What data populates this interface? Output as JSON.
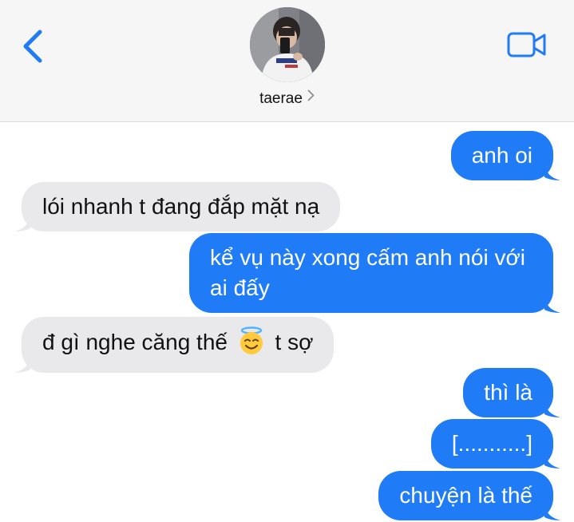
{
  "header": {
    "contact_name": "taerae",
    "back_icon": "chevron-left-icon",
    "video_icon": "video-camera-icon",
    "accent_color": "#1f7bf6"
  },
  "messages": [
    {
      "side": "out",
      "text": "anh oi"
    },
    {
      "side": "in",
      "text": "lói nhanh t đang đắp mặt nạ"
    },
    {
      "side": "out",
      "text": "kể vụ này xong cấm anh nói với ai đấy"
    },
    {
      "side": "in",
      "text_before": "đ gì nghe căng thế",
      "emoji": "smiling-face-with-halo",
      "text_after": "t sợ"
    },
    {
      "side": "out",
      "text": "thì là"
    },
    {
      "side": "out",
      "text": "[...........]"
    },
    {
      "side": "out",
      "text": "chuyện là thế"
    }
  ],
  "colors": {
    "outgoing_bubble": "#1f7bf6",
    "incoming_bubble": "#e9e9eb"
  }
}
